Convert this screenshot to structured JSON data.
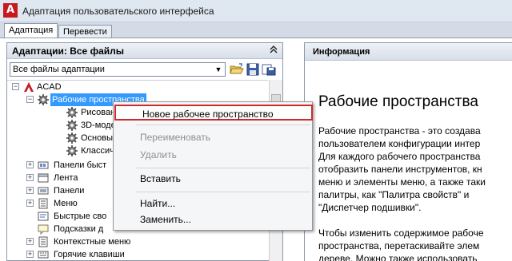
{
  "window": {
    "title": "Адаптация пользовательского интерфейса",
    "logo_letter": "A"
  },
  "tabs": [
    {
      "label": "Адаптация",
      "active": true
    },
    {
      "label": "Перевести",
      "active": false
    }
  ],
  "left_panel": {
    "header": "Адаптации: Все файлы",
    "filter_value": "Все файлы адаптации",
    "tree": [
      {
        "label": "ACAD"
      },
      {
        "label": "Рабочие пространства"
      },
      {
        "label": "Рисование"
      },
      {
        "label": "3D-модел"
      },
      {
        "label": "Основы 3"
      },
      {
        "label": "Классиче"
      },
      {
        "label": "Панели быст"
      },
      {
        "label": "Лента"
      },
      {
        "label": "Панели"
      },
      {
        "label": "Меню"
      },
      {
        "label": "Быстрые сво"
      },
      {
        "label": "Подсказки д"
      },
      {
        "label": "Контекстные меню"
      },
      {
        "label": "Горячие клавиши"
      }
    ]
  },
  "right_panel": {
    "header": "Информация",
    "title": "Рабочие пространства",
    "paragraph1": [
      "Рабочие пространства - это создава",
      "пользователем конфигурации интер",
      "Для каждого рабочего пространства",
      "отобразить панели инструментов, кн",
      "меню и элементы меню, а также таки",
      "палитры, как \"Палитра свойств\" и",
      "\"Диспетчер подшивки\"."
    ],
    "paragraph2": [
      "Чтобы изменить содержимое рабоче",
      "пространства, перетаскивайте элем",
      "дереве. Можно также использовать"
    ]
  },
  "context_menu": {
    "items": [
      {
        "label": "Новое рабочее пространство",
        "state": "highlighted"
      },
      {
        "label": "Переименовать",
        "state": "disabled"
      },
      {
        "label": "Удалить",
        "state": "disabled"
      },
      {
        "label": "Вставить",
        "state": "enabled"
      },
      {
        "label": "Найти...",
        "state": "enabled"
      },
      {
        "label": "Заменить...",
        "state": "enabled"
      }
    ]
  },
  "colors": {
    "selection": "#3399ff",
    "highlight_border": "#cc2b2b",
    "brand_red": "#c7191e"
  }
}
